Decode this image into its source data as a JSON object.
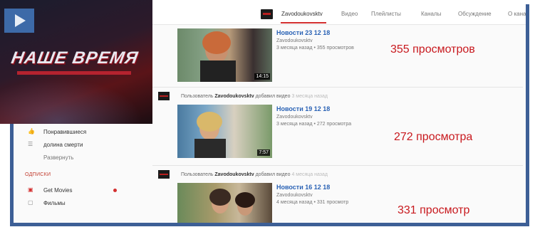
{
  "topbar": {
    "tabs": [
      {
        "label": "Zavodoukovsktv",
        "active": true
      },
      {
        "label": "Видео",
        "active": false
      },
      {
        "label": "Плейлисты",
        "active": false
      },
      {
        "label": "Каналы",
        "active": false
      },
      {
        "label": "Обсуждение",
        "active": false
      },
      {
        "label": "О кана",
        "active": false
      }
    ],
    "accent_color": "#d32f2f"
  },
  "logo": {
    "text": "НАШЕ ВРЕМЯ",
    "badge_icon": "play-icon"
  },
  "sidebar": {
    "items": [
      {
        "label": "Понравившиеся",
        "icon": "thumbs-up-icon"
      },
      {
        "label": "долина смерти",
        "icon": "list-icon"
      },
      {
        "label": "Развернуть",
        "icon": ""
      }
    ],
    "subscriptions_heading": "ОДПИСКИ",
    "subscriptions": [
      {
        "label": "Get Movies",
        "icon": "channel-icon",
        "new": true
      },
      {
        "label": "Фильмы",
        "icon": "channel-icon",
        "new": false
      }
    ]
  },
  "feed": {
    "items": [
      {
        "notice": "",
        "title": "Новости 23 12 18",
        "channel": "Zavodoukovsktv",
        "meta": "3 месяца назад • 355 просмотров",
        "duration": "14:15"
      },
      {
        "notice_user": "Пользователь",
        "notice_channel": "Zavodoukovsktv",
        "notice_action": "добавил видео",
        "notice_ago": "3 месяца назад",
        "title": "Новости 19 12 18",
        "channel": "Zavodoukovsktv",
        "meta": "3 месяца назад • 272 просмотра",
        "duration": "7:57"
      },
      {
        "notice_user": "Пользователь",
        "notice_channel": "Zavodoukovsktv",
        "notice_action": "добавил видео",
        "notice_ago": "4 месяца назад",
        "title": "Новости 16 12 18",
        "channel": "Zavodoukovsktv",
        "meta": "4 месяца назад • 331 просмотр",
        "duration": ""
      }
    ]
  },
  "annotations": [
    "355 просмотров",
    "272 просмотра",
    "331 просмотр"
  ],
  "colors": {
    "annotation": "#c8191e",
    "link": "#2b63b5",
    "frame": "#3d5f96"
  }
}
